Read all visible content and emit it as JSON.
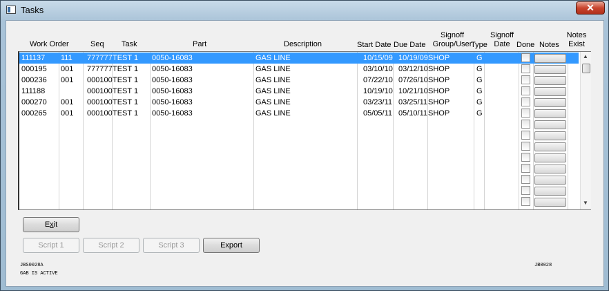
{
  "window": {
    "title": "Tasks",
    "close_label": "✕"
  },
  "columns": {
    "work_order": "Work Order",
    "seq": "Seq",
    "task": "Task",
    "part": "Part",
    "description": "Description",
    "start_date": "Start Date",
    "due_date": "Due Date",
    "signoff_group_1": "Signoff",
    "signoff_group_2": "Group/User",
    "type": "Type",
    "signoff_date_1": "Signoff",
    "signoff_date_2": "Date",
    "done": "Done",
    "notes": "Notes",
    "notes_exist_1": "Notes",
    "notes_exist_2": "Exist"
  },
  "rows": [
    {
      "wo": "111137",
      "wo2": "111",
      "seq": "777777",
      "task": "TEST 1",
      "part": "0050-16083",
      "desc": "GAS LINE",
      "start": "10/15/09",
      "due": "10/19/09",
      "group": "SHOP",
      "type": "G",
      "selected": true
    },
    {
      "wo": "000195",
      "wo2": "001",
      "seq": "777777",
      "task": "TEST 1",
      "part": "0050-16083",
      "desc": "GAS LINE",
      "start": "03/10/10",
      "due": "03/12/10",
      "group": "SHOP",
      "type": "G"
    },
    {
      "wo": "000236",
      "wo2": "001",
      "seq": "000100",
      "task": "TEST 1",
      "part": "0050-16083",
      "desc": "GAS LINE",
      "start": "07/22/10",
      "due": "07/26/10",
      "group": "SHOP",
      "type": "G"
    },
    {
      "wo": "111188",
      "wo2": "",
      "seq": "000100",
      "task": "TEST 1",
      "part": "0050-16083",
      "desc": "GAS LINE",
      "start": "10/19/10",
      "due": "10/21/10",
      "group": "SHOP",
      "type": "G"
    },
    {
      "wo": "000270",
      "wo2": "001",
      "seq": "000100",
      "task": "TEST 1",
      "part": "0050-16083",
      "desc": "GAS LINE",
      "start": "03/23/11",
      "due": "03/25/11",
      "group": "SHOP",
      "type": "G"
    },
    {
      "wo": "000265",
      "wo2": "001",
      "seq": "000100",
      "task": "TEST 1",
      "part": "0050-16083",
      "desc": "GAS LINE",
      "start": "05/05/11",
      "due": "05/10/11",
      "group": "SHOP",
      "type": "G"
    }
  ],
  "buttons": {
    "exit_pre": "E",
    "exit_u": "x",
    "exit_post": "it",
    "script1": "Script 1",
    "script2": "Script 2",
    "script3": "Script 3",
    "export": "Export"
  },
  "footer": {
    "form_id": "JBS0028A",
    "status": "GAB IS ACTIVE",
    "right_id": "JB0028"
  }
}
